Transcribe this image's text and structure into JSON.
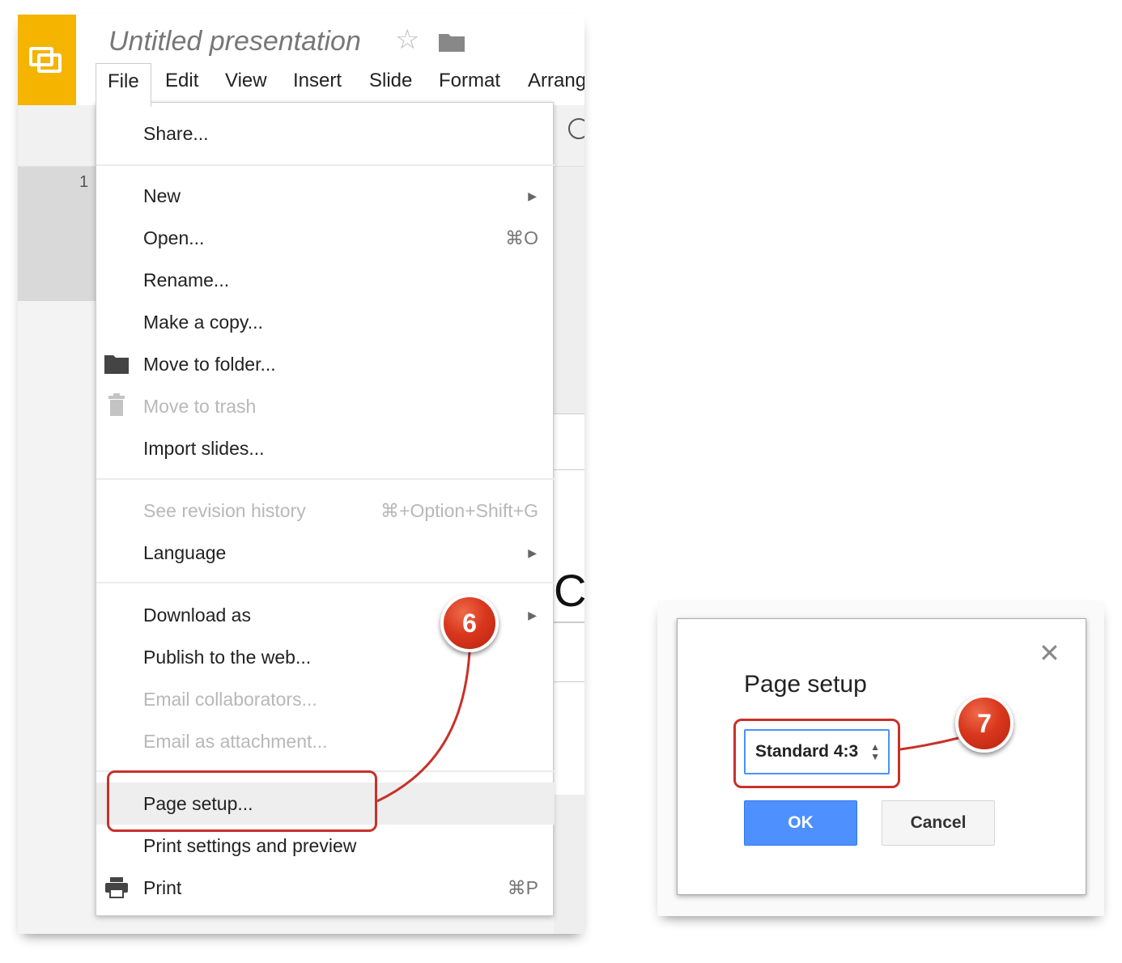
{
  "app": {
    "title": "Untitled presentation",
    "icons": {
      "logo": "slides-logo-icon",
      "star": "star-icon",
      "folder": "folder-icon",
      "comment": "comment-icon"
    },
    "accent_color": "#f4b400"
  },
  "menubar": {
    "items": [
      "File",
      "Edit",
      "View",
      "Insert",
      "Slide",
      "Format",
      "Arrang"
    ]
  },
  "filmstrip": {
    "slide_number": "1"
  },
  "canvas": {
    "visible_letter": "C"
  },
  "file_menu": {
    "share": "Share...",
    "new": "New",
    "open": "Open...",
    "open_shortcut": "⌘O",
    "rename": "Rename...",
    "make_copy": "Make a copy...",
    "move_to_folder": "Move to folder...",
    "move_to_trash": "Move to trash",
    "import_slides": "Import slides...",
    "revision_history": "See revision history",
    "revision_shortcut": "⌘+Option+Shift+G",
    "language": "Language",
    "download_as": "Download as",
    "publish": "Publish to the web...",
    "email_collaborators": "Email collaborators...",
    "email_attachment": "Email as attachment...",
    "page_setup": "Page setup...",
    "print_settings": "Print settings and preview",
    "print": "Print",
    "print_shortcut": "⌘P"
  },
  "callouts": {
    "step6": "6",
    "step7": "7",
    "color": "#c8312a"
  },
  "dialog": {
    "title": "Page setup",
    "close_icon": "close-icon",
    "select_value": "Standard 4:3",
    "ok_label": "OK",
    "cancel_label": "Cancel",
    "ok_color": "#4d90fe"
  }
}
